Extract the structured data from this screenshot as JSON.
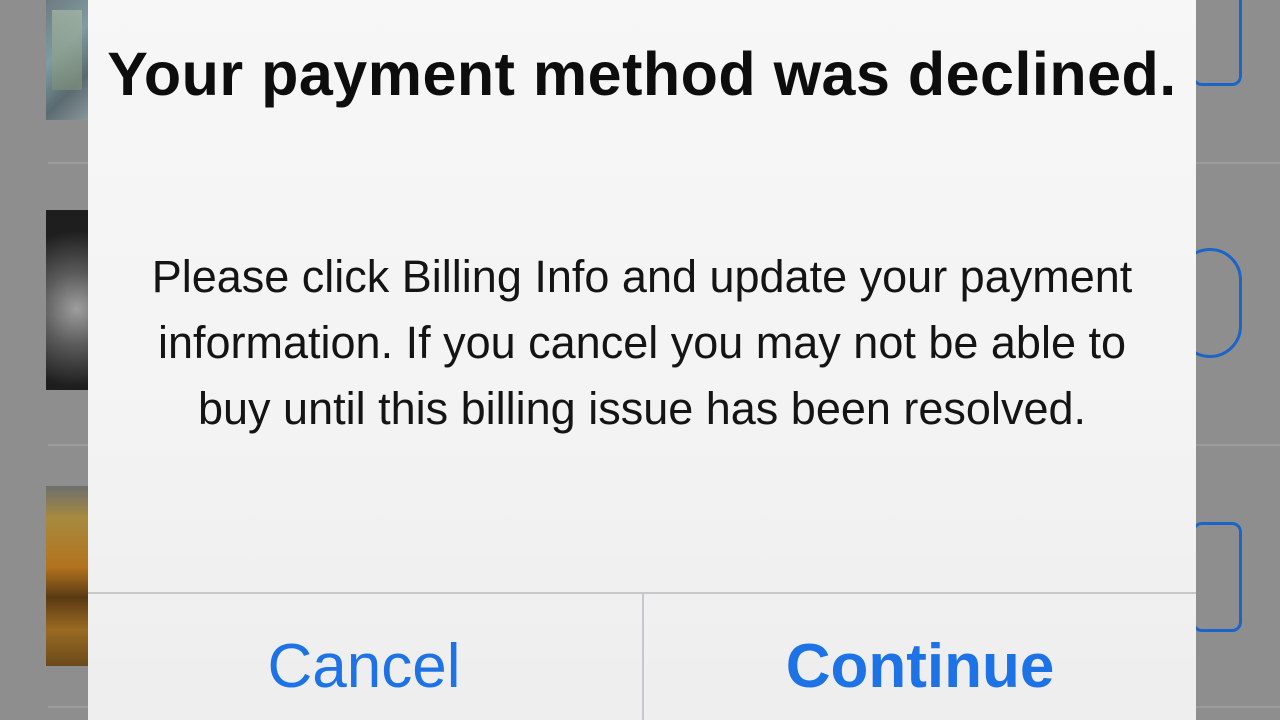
{
  "alert": {
    "title": "Your payment method was declined.",
    "message": "Please click Billing Info and update your payment information. If you cancel you may not be able to buy until this billing issue has been resolved.",
    "buttons": {
      "cancel": "Cancel",
      "continue": "Continue"
    }
  },
  "colors": {
    "accent": "#1d73e6",
    "dim_background": "#8e8e8e",
    "alert_background": "#f5f5f5"
  }
}
